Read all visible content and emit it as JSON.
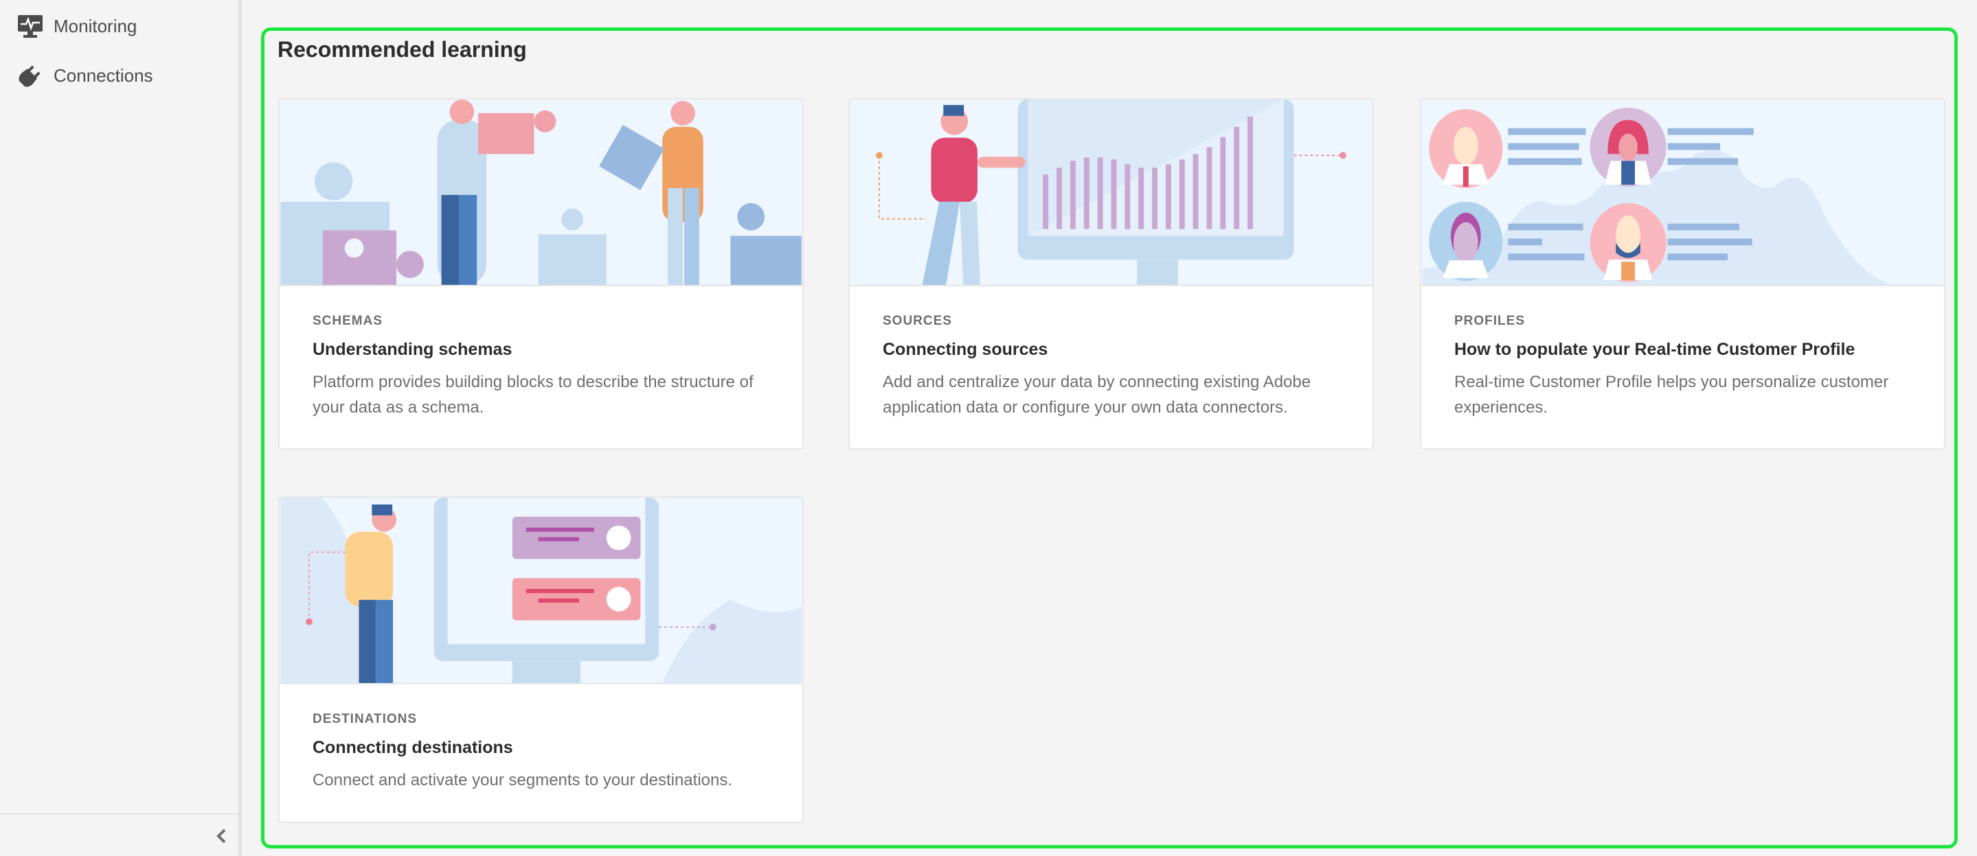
{
  "sidebar": {
    "items": [
      {
        "label": "Monitoring",
        "icon": "monitor-icon"
      },
      {
        "label": "Connections",
        "icon": "plug-icon"
      }
    ],
    "collapse_icon": "chevron-left-icon"
  },
  "main": {
    "title": "Recommended learning",
    "cards": [
      {
        "category": "SCHEMAS",
        "title": "Understanding schemas",
        "description": "Platform provides building blocks to describe the structure of your data as a schema."
      },
      {
        "category": "SOURCES",
        "title": "Connecting sources",
        "description": "Add and centralize your data by connecting existing Adobe application data or configure your own data connectors."
      },
      {
        "category": "PROFILES",
        "title": "How to populate your Real-time Customer Profile",
        "description": "Real-time Customer Profile helps you personalize customer experiences."
      },
      {
        "category": "DESTINATIONS",
        "title": "Connecting destinations",
        "description": "Connect and activate your segments to your destinations."
      }
    ]
  },
  "colors": {
    "accent_frame": "#1ee53e",
    "illustration_bg": "#eef6ff"
  }
}
